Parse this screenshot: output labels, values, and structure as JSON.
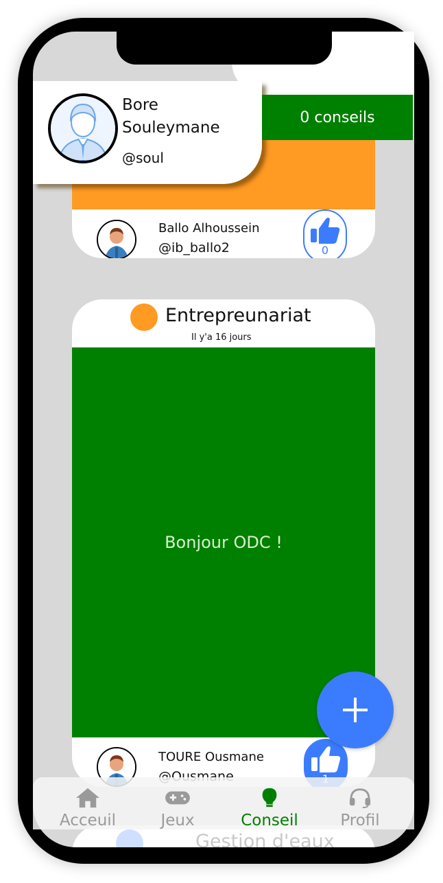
{
  "profile": {
    "first_name": "Bore",
    "last_name": "Souleymane",
    "handle": "@soul",
    "conseils_label": "0 conseils"
  },
  "posts": [
    {
      "author_name": "Ballo Alhoussein",
      "author_handle": "@ib_ballo2",
      "likes": "0",
      "band_color": "#ff9a22"
    },
    {
      "category": "Entrepreunariat",
      "time_ago": "Il y'a 16 jours",
      "message": "Bonjour ODC !",
      "author_name": "TOURE Ousmane",
      "author_handle": "@Ousmane",
      "likes": "1",
      "band_color": "#008000"
    },
    {
      "category": "Gestion d'eaux"
    }
  ],
  "fab": {
    "icon": "plus-icon"
  },
  "nav": {
    "items": [
      {
        "label": "Acceuil",
        "icon": "home-icon",
        "active": false
      },
      {
        "label": "Jeux",
        "icon": "gamepad-icon",
        "active": false
      },
      {
        "label": "Conseil",
        "icon": "lightbulb-icon",
        "active": true
      },
      {
        "label": "Profil",
        "icon": "headset-icon",
        "active": false
      }
    ]
  },
  "colors": {
    "green": "#008000",
    "orange": "#ff9a22",
    "blue": "#3b7cff"
  }
}
